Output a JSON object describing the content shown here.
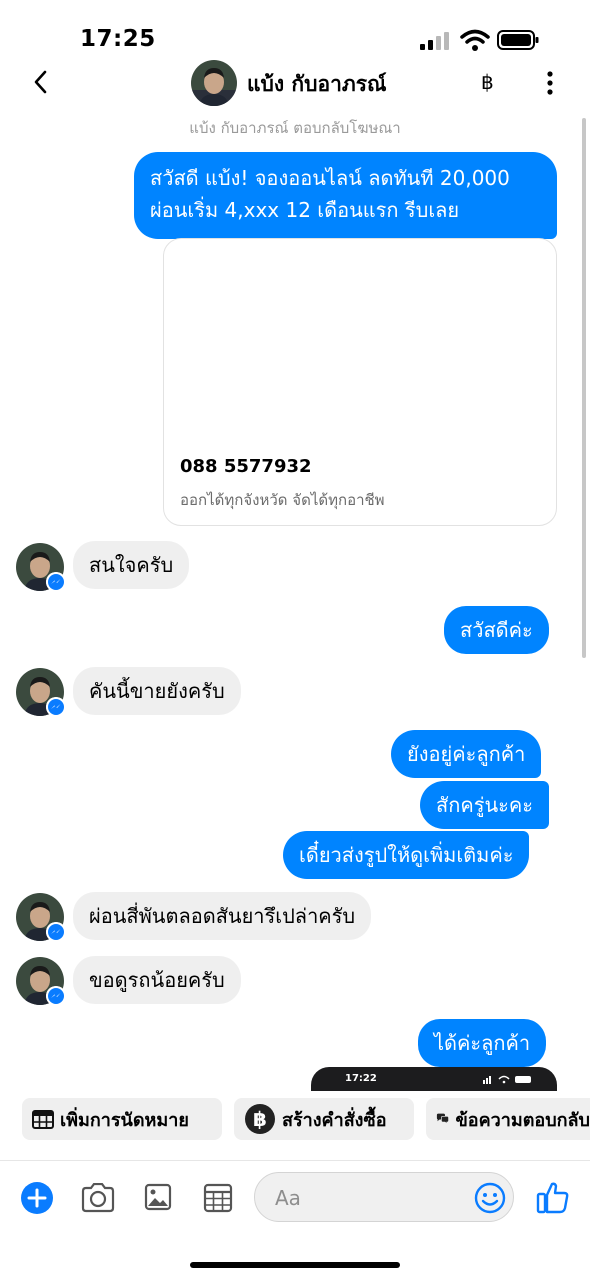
{
  "status": {
    "time": "17:25"
  },
  "header": {
    "contact_name": "แบ้ง กับอาภรณ์",
    "subtitle": "แบ้ง กับอาภรณ์ ตอบกลับโฆษณา",
    "baht_symbol": "฿"
  },
  "messages": {
    "ad_text_line1": "สวัสดี แบ้ง! จองออนไลน์ ลดทันที 20,000",
    "ad_text_line2": "ผ่อนเริ่ม 4,xxx 12 เดือนแรก รีบเลย",
    "card_phone": "088 5577932",
    "card_desc": "ออกได้ทุกจังหวัด จัดได้ทุกอาชีพ",
    "in_1": "สนใจครับ",
    "out_1": "สวัสดีค่ะ",
    "in_2": "คันนี้ขายยังครับ",
    "out_2": "ยังอยู่ค่ะลูกค้า",
    "out_3": "สักครู่นะคะ",
    "out_4": "เดี๋ยวส่งรูปให้ดูเพิ่มเติมค่ะ",
    "in_3": "ผ่อนสี่พันตลอดสันยารึเปล่าครับ",
    "in_4": "ขอดูรถน้อยครับ",
    "out_5": "ได้ค่ะลูกค้า",
    "photo_time": "17:22"
  },
  "quick_actions": {
    "appointment": "เพิ่มการนัดหมาย",
    "order": "สร้างคำสั่งซื้อ",
    "saved_reply": "ข้อความตอบกลับ"
  },
  "composer": {
    "placeholder": "Aa"
  },
  "colors": {
    "accent": "#0084ff",
    "incoming_bubble": "#efefef"
  }
}
